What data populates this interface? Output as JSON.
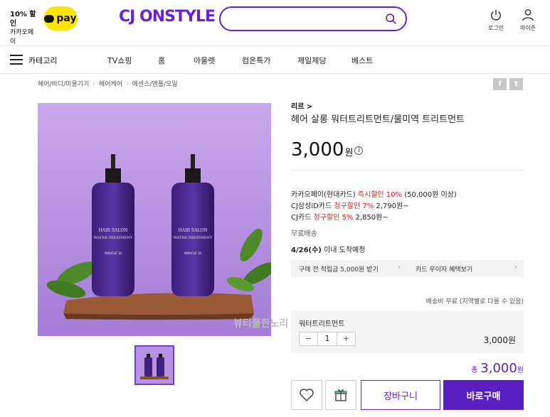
{
  "header": {
    "pay_promo_line1": "10% 할인",
    "pay_promo_line2": "카카오페이",
    "pay_label": "pay",
    "logo": "CJ ONSTYLE",
    "search_placeholder": "",
    "login_label": "로그인",
    "mypage_label": "마이존"
  },
  "nav": {
    "category_label": "카테고리",
    "items": [
      "TV쇼핑",
      "홈",
      "아울렛",
      "컴온특가",
      "제일제당",
      "베스트"
    ]
  },
  "breadcrumb": [
    "헤어/바디/미용기기",
    "헤어케어",
    "에센스/앰플/오일"
  ],
  "share": {
    "facebook": "f",
    "twitter": "t"
  },
  "product": {
    "brand": "리르 >",
    "name": "헤어 살롱 워터트리트먼트/물미역 트리트먼트",
    "price": "3,000",
    "price_unit": "원",
    "price_info": "i",
    "bottle_label_1": "HAIR SALON",
    "bottle_label_2": "WATER TREATMENT",
    "bottle_label_3": "MIRACLE 10",
    "watermark": "뷰티풀한노리"
  },
  "benefits": [
    {
      "pre": "카카오페이(현대카드) ",
      "red": "즉시할인 10%",
      "post": " (50,000원 이상)"
    },
    {
      "pre": "CJ삼성iD카드 ",
      "red": "청구할인 7%",
      "post": " 2,790원~"
    },
    {
      "pre": "CJ카드 ",
      "red": "청구할인 5%",
      "post": " 2,850원~"
    }
  ],
  "shipping": {
    "free": "무료배송",
    "arrival_bold": "4/26(수)",
    "arrival_rest": " 이내 도착예정",
    "note": "배송비 무료 (지역별로 다를 수 있음)"
  },
  "promo_bar": {
    "left": "구매 전 적립금 5,000원 받기",
    "right": "카드 무이자 혜택보기"
  },
  "option": {
    "name": "워터트리트먼트",
    "quantity": "1",
    "minus": "−",
    "plus": "+",
    "price": "3,000원"
  },
  "total": {
    "label": "총",
    "amount": "3,000",
    "unit": "원"
  },
  "buttons": {
    "cart": "장바구니",
    "buy": "바로구매"
  },
  "colors": {
    "brand_purple": "#5a1fc0",
    "discount_red": "#e02020",
    "kakao_yellow": "#fee500"
  }
}
